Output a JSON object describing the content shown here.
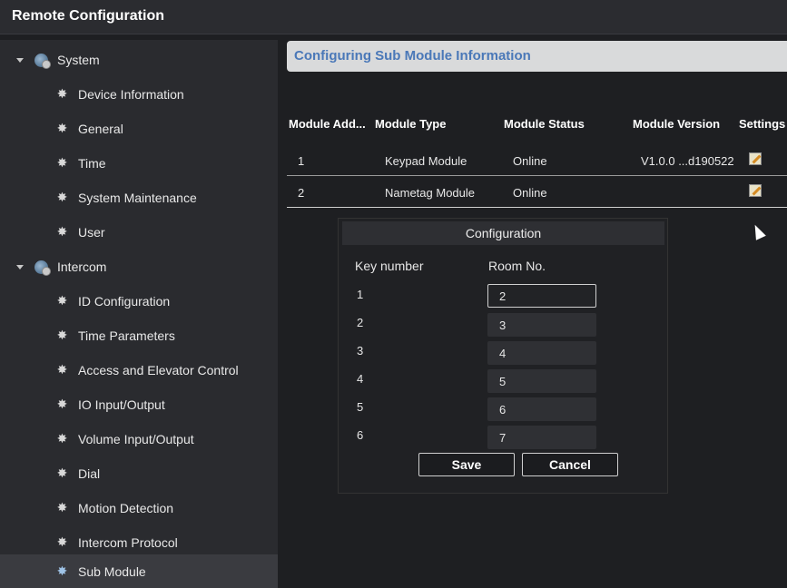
{
  "window": {
    "title": "Remote Configuration"
  },
  "sidebar": {
    "groups": [
      {
        "label": "System"
      },
      {
        "label": "Intercom"
      }
    ],
    "system_items": [
      {
        "label": "Device Information"
      },
      {
        "label": "General"
      },
      {
        "label": "Time"
      },
      {
        "label": "System Maintenance"
      },
      {
        "label": "User"
      }
    ],
    "intercom_items": [
      {
        "label": "ID Configuration"
      },
      {
        "label": "Time Parameters"
      },
      {
        "label": "Access and Elevator Control"
      },
      {
        "label": "IO Input/Output"
      },
      {
        "label": "Volume Input/Output"
      },
      {
        "label": "Dial"
      },
      {
        "label": "Motion Detection"
      },
      {
        "label": "Intercom Protocol"
      },
      {
        "label": "Sub Module"
      }
    ],
    "active_item": "Sub Module"
  },
  "main": {
    "header_title": "Configuring Sub Module Information",
    "columns": [
      "Module Add...",
      "Module Type",
      "Module Status",
      "Module Version",
      "Settings"
    ],
    "rows": [
      {
        "address": "1",
        "type": "Keypad Module",
        "status": "Online",
        "version": "V1.0.0 ...d190522"
      },
      {
        "address": "2",
        "type": "Nametag Module",
        "status": "Online",
        "version": ""
      }
    ]
  },
  "dialog": {
    "title": "Configuration",
    "col_key": "Key number",
    "col_room": "Room No.",
    "entries": [
      {
        "key": "1",
        "room": "2"
      },
      {
        "key": "2",
        "room": "3"
      },
      {
        "key": "3",
        "room": "4"
      },
      {
        "key": "4",
        "room": "5"
      },
      {
        "key": "5",
        "room": "6"
      },
      {
        "key": "6",
        "room": "7"
      }
    ],
    "save_label": "Save",
    "cancel_label": "Cancel"
  },
  "colors": {
    "header_title": "#4a78b8",
    "background": "#1e1f22",
    "sidebar": "#2a2b2f"
  }
}
